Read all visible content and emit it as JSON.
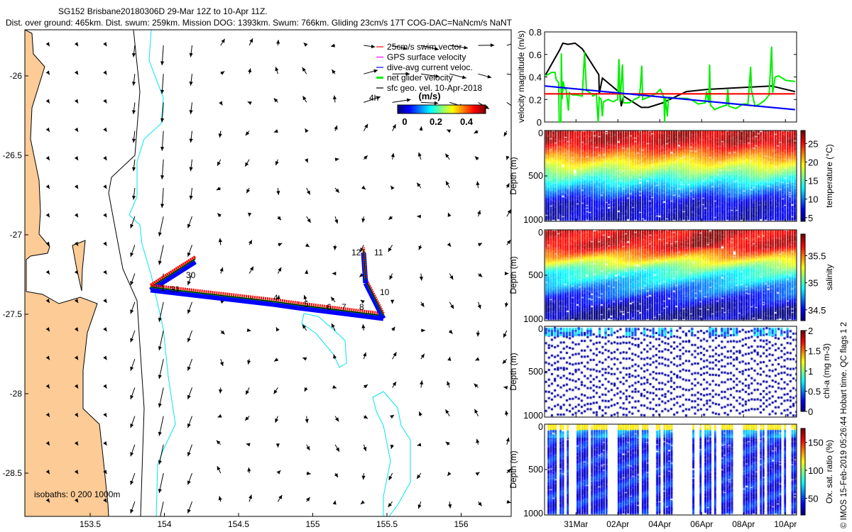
{
  "title": {
    "line1": "SG152 Brisbane20180306D 29-Mar 12Z to 10-Apr 11Z.",
    "line2": "Dist. over ground: 465km. Dist. swum: 259km. Mission DOG: 1393km. Swum: 766km. Gliding 23cm/s 17T COG-DAC=NaNcm/s NaNT"
  },
  "map": {
    "lon_ticks": [
      "153.5",
      "154",
      "154.5",
      "155",
      "155.5",
      "156"
    ],
    "lat_ticks": [
      "-26",
      "-26.5",
      "-27",
      "-27.5",
      "-28",
      "-28.5"
    ],
    "legend": [
      "25cm/s swim vector",
      "GPS surface velocity",
      "dive-avg current veloc.",
      "net glider velocity",
      "sfc geo. vel. 10-Apr-2018"
    ],
    "legend_colors": [
      "#ff0000",
      "#ff00ff",
      "#0000ff",
      "#00ee00",
      "#000000"
    ],
    "time_step_label": "4h",
    "colorbar_unit": "(m/s)",
    "colorbar_ticks": [
      "0",
      "0.2",
      "0.4"
    ],
    "isobaths_label": "isobaths: 0   200  1000m",
    "day_labels": [
      "30",
      "31",
      "1",
      "4",
      "5",
      "6",
      "7",
      "8",
      "10",
      "11",
      "12"
    ],
    "track": [
      [
        153.907,
        -27.33
      ],
      [
        154.208,
        -27.152
      ],
      [
        153.907,
        -27.33
      ],
      [
        154.734,
        -27.42
      ],
      [
        154.902,
        -27.442
      ],
      [
        155.476,
        -27.509
      ],
      [
        155.356,
        -27.286
      ],
      [
        155.342,
        -27.094
      ]
    ],
    "land_color": "#fccb96",
    "isobath_200_color": "#000000",
    "isobath_1000_color": "#00e5ee"
  },
  "chart_data": [
    {
      "type": "line",
      "ylabel": "velocity magnitude (m/s)",
      "ylim": [
        0,
        0.8
      ],
      "yticks": [
        "0",
        "0.2",
        "0.4",
        "0.6",
        "0.8"
      ],
      "x_units": "days since 29-Mar 00Z",
      "xlim": [
        0.5,
        12.46
      ],
      "series": [
        {
          "name": "black",
          "color": "#000000",
          "x": [
            0.55,
            1.22,
            1.37,
            1.62,
            1.96,
            2.3,
            3.09,
            3.11,
            3.26,
            4.1,
            4.16,
            4.27,
            5.12,
            5.46,
            6.14,
            6.36,
            7.27,
            8.29,
            9.3,
            11.34,
            11.56,
            12.46
          ],
          "y": [
            0.42,
            0.64,
            0.7,
            0.69,
            0.7,
            0.65,
            0.42,
            0.25,
            0.39,
            0.26,
            0.14,
            0.23,
            0.13,
            0.13,
            0.17,
            0.19,
            0.27,
            0.29,
            0.3,
            0.32,
            0.31,
            0.27
          ]
        },
        {
          "name": "green",
          "color": "#00ee00",
          "x": [
            0.55,
            0.83,
            1.0,
            1.05,
            1.17,
            1.2,
            1.28,
            1.3,
            1.34,
            1.39,
            1.45,
            1.53,
            1.6,
            1.64,
            1.68,
            1.84,
            2.01,
            2.3,
            2.41,
            2.5,
            2.75,
            2.81,
            2.97,
            3.06,
            3.11,
            3.2,
            3.26,
            3.31,
            3.54,
            3.77,
            3.99,
            4.05,
            4.1,
            4.22,
            4.27,
            4.56,
            4.78,
            5.01,
            5.07,
            5.14,
            5.18,
            5.46,
            5.8,
            6.03,
            6.2,
            6.23,
            6.27,
            6.36,
            6.42,
            6.82,
            7.27,
            7.5,
            7.83,
            8.17,
            8.23,
            8.34,
            8.38,
            8.42,
            8.62,
            8.85,
            9.19,
            9.25,
            9.3,
            9.64,
            9.98,
            10.21,
            10.34,
            10.38,
            10.55,
            10.77,
            11.0,
            11.22,
            11.34,
            11.39,
            11.51,
            11.68,
            12.01,
            12.46
          ],
          "y": [
            0.41,
            0.44,
            0.44,
            0.38,
            0.35,
            0.0,
            0.0,
            0.61,
            0.2,
            0.36,
            0.3,
            0.29,
            0.17,
            0.1,
            0.26,
            0.24,
            0.24,
            0.23,
            0.62,
            0.28,
            0.25,
            0.23,
            0.25,
            0.0,
            0.22,
            0.2,
            0.05,
            0.18,
            0.2,
            0.18,
            0.2,
            0.56,
            0.18,
            0.51,
            0.17,
            0.17,
            0.2,
            0.22,
            0.3,
            0.5,
            0.2,
            0.22,
            0.25,
            0.29,
            0.22,
            0.0,
            0.22,
            0.05,
            0.22,
            0.21,
            0.21,
            0.2,
            0.16,
            0.17,
            0.27,
            0.17,
            0.51,
            0.15,
            0.11,
            0.13,
            0.15,
            0.29,
            0.14,
            0.12,
            0.16,
            0.16,
            0.49,
            0.28,
            0.14,
            0.16,
            0.19,
            0.24,
            0.67,
            0.26,
            0.4,
            0.41,
            0.37,
            0.36
          ]
        },
        {
          "name": "red",
          "color": "#ff0000",
          "x": [
            0.5,
            12.46
          ],
          "y": [
            0.25,
            0.25
          ]
        },
        {
          "name": "blue",
          "color": "#0000ff",
          "x": [
            0.5,
            12.46
          ],
          "y": [
            0.32,
            0.11
          ]
        }
      ]
    },
    {
      "type": "scatter",
      "variable": "temperature",
      "colorbar_label": "temperature (°C)",
      "clim": [
        4,
        28.5
      ],
      "cticks": [
        "5",
        "10",
        "15",
        "20",
        "25"
      ],
      "ctick_values": [
        5,
        10,
        15,
        20,
        25
      ],
      "ylabel": "Depth (m)",
      "ylim": [
        0,
        1000
      ],
      "yticks": [
        "0",
        "500",
        "1000"
      ]
    },
    {
      "type": "scatter",
      "variable": "salinity",
      "colorbar_label": "salinity",
      "clim": [
        34.3,
        35.9
      ],
      "cticks": [
        "34.5",
        "35",
        "35.5"
      ],
      "ctick_values": [
        34.5,
        35,
        35.5
      ],
      "ylabel": "Depth (m)",
      "ylim": [
        0,
        1000
      ],
      "yticks": [
        "0",
        "500",
        "1000"
      ]
    },
    {
      "type": "scatter",
      "variable": "chl-a",
      "colorbar_label": "chl-a (mg m-3)",
      "clim": [
        0,
        2
      ],
      "cticks": [
        "0",
        "0.5",
        "1",
        "1.5",
        "2"
      ],
      "ctick_values": [
        0,
        0.5,
        1,
        1.5,
        2
      ],
      "ylabel": "Depth (m)",
      "ylim": [
        0,
        1000
      ],
      "yticks": [
        "0",
        "500",
        "1000"
      ]
    },
    {
      "type": "scatter",
      "variable": "oxygen",
      "colorbar_label": "Ox. sat. ratio (%)",
      "clim": [
        20,
        175
      ],
      "cticks": [
        "50",
        "100",
        "150"
      ],
      "ctick_values": [
        50,
        100,
        150
      ],
      "ylabel": "Depth (m)",
      "ylim": [
        0,
        1000
      ],
      "yticks": [
        "0",
        "500",
        "1000"
      ]
    }
  ],
  "time_axis": {
    "labels": [
      "31Mar",
      "02Apr",
      "04Apr",
      "06Apr",
      "08Apr",
      "10Apr"
    ],
    "values": [
      2,
      4,
      6,
      8,
      10,
      12
    ]
  },
  "footer": "© IMOS 15-Feb-2019 05:26:44 Hobart time. QC flags 1  2"
}
